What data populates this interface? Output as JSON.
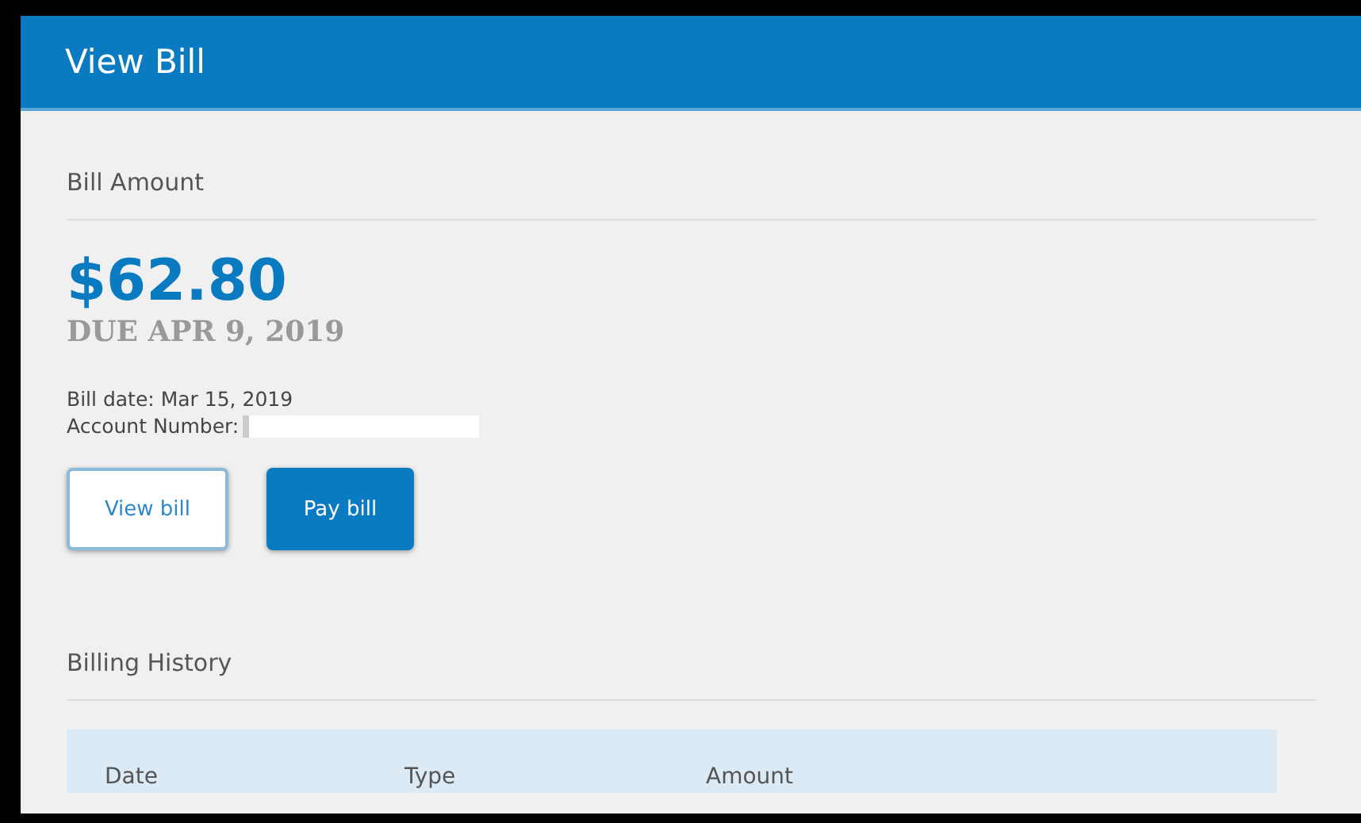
{
  "header": {
    "title": "View Bill"
  },
  "bill": {
    "section_title": "Bill Amount",
    "amount": "$62.80",
    "due": "DUE APR 9, 2019",
    "bill_date": "Bill date: Mar 15, 2019",
    "account_label": "Account Number:"
  },
  "buttons": [
    {
      "label": "View bill",
      "kind": "outline"
    },
    {
      "label": "Pay bill",
      "kind": "primary"
    }
  ],
  "history": {
    "section_title": "Billing History",
    "columns": [
      "Date",
      "Type",
      "Amount"
    ]
  }
}
